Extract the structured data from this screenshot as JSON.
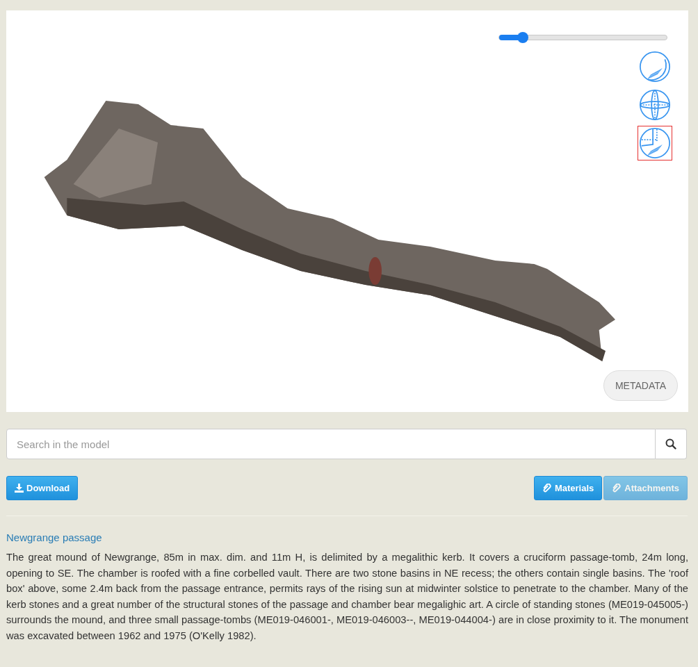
{
  "viewer": {
    "slider": {
      "level": 0.14
    },
    "view_modes": [
      {
        "kind": "lighting",
        "selected": false
      },
      {
        "kind": "axes",
        "selected": false
      },
      {
        "kind": "section",
        "selected": true
      }
    ],
    "metadata_button": "METADATA"
  },
  "search": {
    "placeholder": "Search in the model"
  },
  "buttons": [
    {
      "kind": "download",
      "label": "Download",
      "disabled": false
    },
    {
      "kind": "materials",
      "label": "Materials",
      "disabled": false
    },
    {
      "kind": "attachments",
      "label": "Attachments",
      "disabled": true
    }
  ],
  "title": "Newgrange passage",
  "description": "The great mound of Newgrange, 85m in max. dim. and 11m H, is delimited by a megalithic kerb. It covers a cruciform passage-tomb, 24m long, opening to SE. The chamber is roofed with a fine corbelled vault. There are two stone basins in NE recess; the others contain single basins. The 'roof box' above, some 2.4m back from the passage entrance, permits rays of the rising sun at midwinter solstice to penetrate to the chamber. Many of the kerb stones and a great number of the structural stones of the passage and chamber bear megalighic art. A circle of standing stones (ME019-045005-) surrounds the mound, and three small passage-tombs (ME019-046001-, ME019-046003--, ME019-044004-) are in close proximity to it. The monument was excavated between 1962 and 1975 (O'Kelly 1982)."
}
